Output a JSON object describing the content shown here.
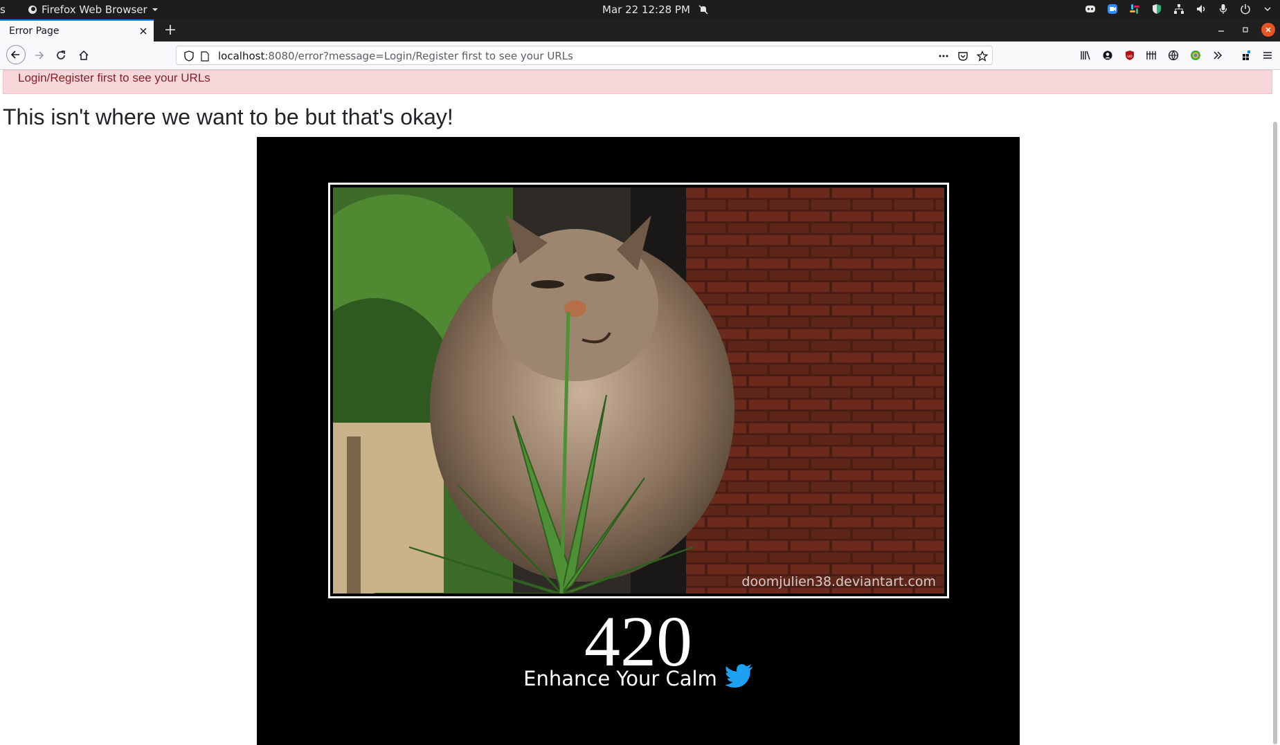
{
  "topbar": {
    "activities": "s",
    "app_name": "Firefox Web Browser",
    "clock": "Mar 22  12:28 PM",
    "tray_icons": [
      "discord-icon",
      "zoom-icon",
      "slack-icon",
      "shield-icon",
      "network-icon",
      "volume-icon",
      "microphone-icon",
      "power-icon"
    ]
  },
  "browser": {
    "tab_title": "Error Page",
    "url_host": "localhost",
    "url_rest": ":8080/error?message=Login/Register first to see your URLs"
  },
  "page": {
    "alert_text": "Login/Register first to see your URLs",
    "heading": "This isn't where we want to be but that's okay!",
    "poster": {
      "watermark": "doomjulien38.deviantart.com",
      "code": "420",
      "tagline": "Enhance Your Calm"
    }
  },
  "colors": {
    "alert_bg": "#f8d7da",
    "alert_text": "#842029",
    "accent": "#0a84ff",
    "twitter_blue": "#1da1f2"
  }
}
